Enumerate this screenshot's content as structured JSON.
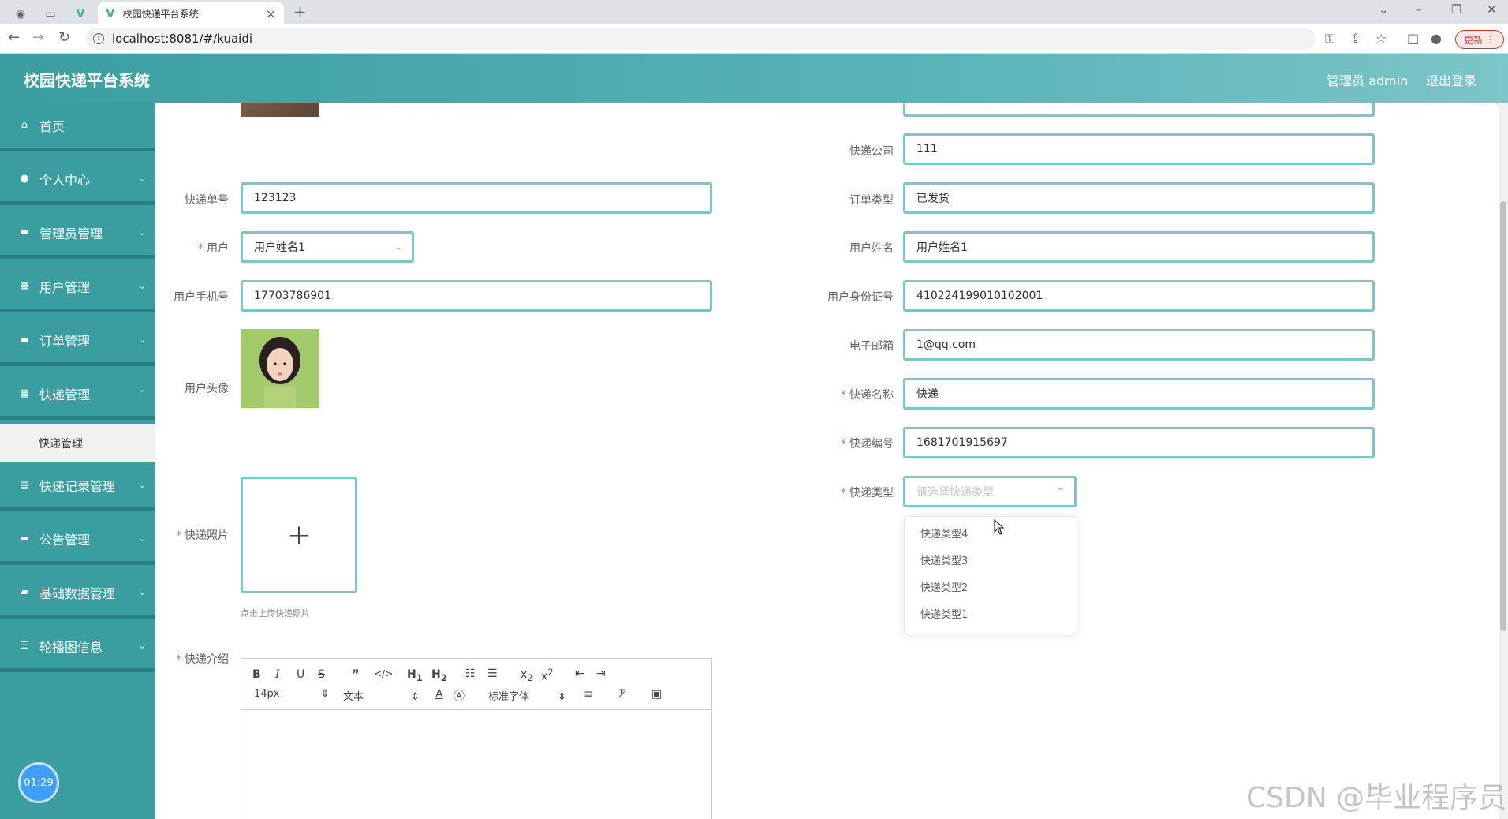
{
  "browser": {
    "tab_title": "校园快递平台系统",
    "url": "localhost:8081/#/kuaidi",
    "update_label": "更新"
  },
  "header": {
    "title": "校园快递平台系统",
    "user": "管理员 admin",
    "logout": "退出登录"
  },
  "sidebar": {
    "items": [
      {
        "label": "首页",
        "icon": "home-icon"
      },
      {
        "label": "个人中心",
        "icon": "user-icon"
      },
      {
        "label": "管理员管理",
        "icon": "chat-icon"
      },
      {
        "label": "用户管理",
        "icon": "grid-icon"
      },
      {
        "label": "订单管理",
        "icon": "box-icon"
      },
      {
        "label": "快递管理",
        "icon": "grid-icon"
      },
      {
        "label": "快递记录管理",
        "icon": "clipboard-icon"
      },
      {
        "label": "公告管理",
        "icon": "chat-icon"
      },
      {
        "label": "基础数据管理",
        "icon": "layers-icon"
      },
      {
        "label": "轮播图信息",
        "icon": "sliders-icon"
      }
    ],
    "submenu": "快递管理",
    "clock": "01:29"
  },
  "form": {
    "left": {
      "tracking_no": {
        "label": "快递单号",
        "value": "123123"
      },
      "user": {
        "label": "用户",
        "value": "用户姓名1"
      },
      "phone": {
        "label": "用户手机号",
        "value": "17703786901"
      },
      "avatar": {
        "label": "用户头像"
      },
      "photo": {
        "label": "快递照片",
        "tip": "点击上传快递照片"
      },
      "intro": {
        "label": "快递介绍"
      }
    },
    "right": {
      "company": {
        "label": "快递公司",
        "value": "111"
      },
      "order_type": {
        "label": "订单类型",
        "value": "已发货"
      },
      "user_name": {
        "label": "用户姓名",
        "value": "用户姓名1"
      },
      "id_card": {
        "label": "用户身份证号",
        "value": "410224199010102001"
      },
      "email": {
        "label": "电子邮箱",
        "value": "1@qq.com"
      },
      "express_name": {
        "label": "快递名称",
        "value": "快递"
      },
      "express_no": {
        "label": "快递编号",
        "value": "1681701915697"
      },
      "express_type": {
        "label": "快递类型",
        "placeholder": "请选择快递类型"
      }
    },
    "dropdown_options": [
      "快递类型4",
      "快递类型3",
      "快递类型2",
      "快递类型1"
    ]
  },
  "editor": {
    "font_size": "14px",
    "block_type": "文本",
    "font_family": "标准字体"
  },
  "watermark": "CSDN @毕业程序员"
}
